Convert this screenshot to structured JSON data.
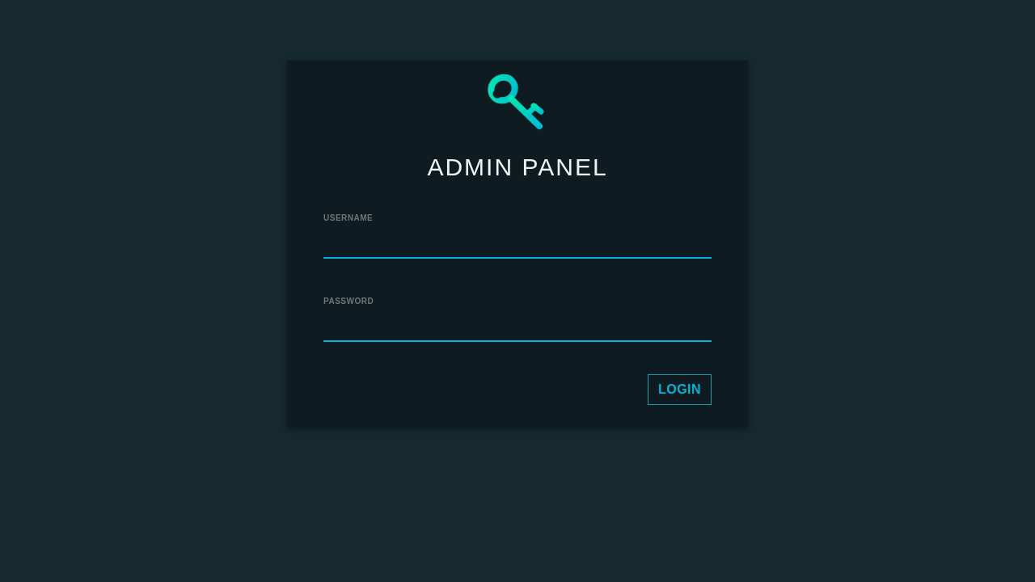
{
  "title": "ADMIN PANEL",
  "fields": [
    {
      "label": "USERNAME"
    },
    {
      "label": "PASSWORD"
    }
  ],
  "button": "LOGIN"
}
